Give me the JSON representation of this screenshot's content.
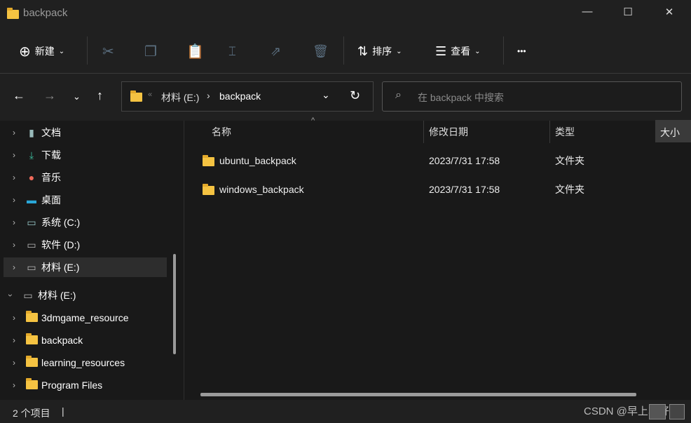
{
  "window": {
    "title": "backpack",
    "minimize": "—",
    "maximize": "☐",
    "close": "✕"
  },
  "toolbar": {
    "new_label": "新建",
    "sort_label": "排序",
    "view_label": "查看",
    "more": "•••"
  },
  "address": {
    "separator": "«",
    "drive": "材料 (E:)",
    "arrow": "›",
    "folder": "backpack"
  },
  "search": {
    "placeholder": "在 backpack 中搜索"
  },
  "sidebar": {
    "items": [
      {
        "label": "文档"
      },
      {
        "label": "下载"
      },
      {
        "label": "音乐"
      },
      {
        "label": "桌面"
      },
      {
        "label": "系统 (C:)"
      },
      {
        "label": "软件 (D:)"
      },
      {
        "label": "材料 (E:)"
      },
      {
        "label": "材料 (E:)"
      },
      {
        "label": "3dmgame_resource"
      },
      {
        "label": "backpack"
      },
      {
        "label": "learning_resources"
      },
      {
        "label": "Program Files"
      }
    ]
  },
  "columns": {
    "name": "名称",
    "date": "修改日期",
    "type": "类型",
    "size": "大小"
  },
  "files": [
    {
      "name": "ubuntu_backpack",
      "date": "2023/7/31 17:58",
      "type": "文件夹"
    },
    {
      "name": "windows_backpack",
      "date": "2023/7/31 17:58",
      "type": "文件夹"
    }
  ],
  "status": {
    "count": "2 个项目",
    "cursor": "|"
  },
  "watermark": "CSDN @早上真好"
}
